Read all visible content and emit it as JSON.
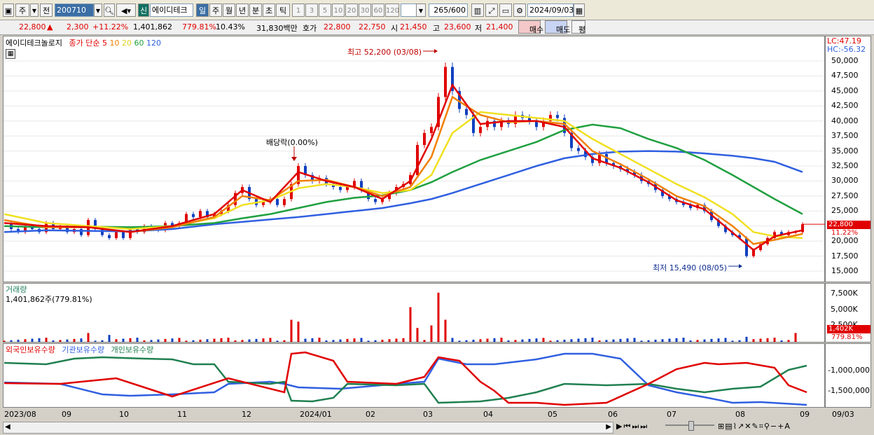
{
  "toolbar": {
    "period_label": "주",
    "prev_label": "전",
    "code_value": "200710",
    "new_badge": "신",
    "stock_name": "에이디테크",
    "periods": [
      "일",
      "주",
      "월",
      "년",
      "분",
      "초",
      "틱"
    ],
    "intervals": [
      "1",
      "3",
      "5",
      "10",
      "20",
      "30",
      "60",
      "120"
    ],
    "count_value": "265",
    "count_total": "/600",
    "date_value": "2024/09/03"
  },
  "quote": {
    "price": "22,800",
    "arrow": "▲",
    "change": "2,300",
    "change_pct": "+11.22%",
    "volume": "1,401,862",
    "volume_pct": "779.81%",
    "turnover": "10.43%",
    "amount": "31,830백만",
    "bid_label": "호가",
    "ask_price": "22,800",
    "bid_price": "22,750",
    "open_label": "시",
    "open": "21,450",
    "high_label": "고",
    "high": "23,600",
    "low_label": "저",
    "low": "21,400",
    "buy_button": "매수",
    "sell_button": "매도",
    "eval_button": "평"
  },
  "price_panel": {
    "name": "에이디테크놀로지",
    "ma_label": "종가 단순",
    "ma_periods": [
      "5",
      "10",
      "20",
      "60",
      "120"
    ],
    "ma_colors": [
      "#e00000",
      "#f08000",
      "#f0e020",
      "#20a040",
      "#3060e0"
    ],
    "lc": "LC:47.19",
    "hc": "HC:-56.32",
    "max_annotation": "최고 52,200 (03/08)",
    "min_annotation": "최저 15,490 (08/05)",
    "dividend_annotation": "배당락(0.00%)",
    "y_ticks": [
      "50,000",
      "47,500",
      "45,000",
      "42,500",
      "40,000",
      "37,500",
      "35,000",
      "32,500",
      "30,000",
      "27,500",
      "25,000",
      "22,500",
      "20,000",
      "17,500",
      "15,000"
    ],
    "current_tag": "22,800",
    "current_pct_tag": "11.22%"
  },
  "volume_panel": {
    "title": "거래량",
    "value": "1,401,862주(779.81%)",
    "y_ticks": [
      "7,500K",
      "5,000K",
      "2,500K"
    ],
    "current_tag": "1,402K",
    "current_pct_tag": "779.81%"
  },
  "holdings_panel": {
    "series": [
      "외국인보유수량",
      "기관보유수량",
      "개인보유수량"
    ],
    "colors": [
      "#e00000",
      "#3060e0",
      "#208050"
    ],
    "y_ticks": [
      "-1,000,000",
      "-1,500,000"
    ]
  },
  "x_labels": [
    "2023/08",
    "09",
    "10",
    "11",
    "12",
    "2024/01",
    "02",
    "03",
    "04",
    "05",
    "06",
    "07",
    "08",
    "09",
    "09/03"
  ],
  "chart_data": {
    "type": "line",
    "y_range": [
      14000,
      52500
    ],
    "close_path": [
      [
        0,
        23000
      ],
      [
        10,
        22000
      ],
      [
        20,
        21500
      ],
      [
        30,
        22500
      ],
      [
        40,
        22000
      ],
      [
        50,
        21500
      ],
      [
        60,
        23000
      ],
      [
        70,
        22000
      ],
      [
        80,
        22500
      ],
      [
        90,
        21500
      ],
      [
        100,
        22000
      ],
      [
        110,
        21000
      ],
      [
        120,
        23500
      ],
      [
        130,
        22000
      ],
      [
        140,
        21000
      ],
      [
        150,
        20500
      ],
      [
        160,
        21500
      ],
      [
        170,
        20500
      ],
      [
        180,
        22000
      ],
      [
        190,
        21500
      ],
      [
        200,
        22500
      ],
      [
        210,
        22000
      ],
      [
        220,
        21800
      ],
      [
        230,
        23000
      ],
      [
        240,
        22500
      ],
      [
        250,
        23000
      ],
      [
        260,
        24500
      ],
      [
        270,
        24000
      ],
      [
        280,
        25000
      ],
      [
        290,
        24000
      ],
      [
        300,
        24500
      ],
      [
        310,
        25000
      ],
      [
        320,
        26000
      ],
      [
        330,
        28000
      ],
      [
        340,
        29000
      ],
      [
        350,
        27000
      ],
      [
        360,
        26000
      ],
      [
        370,
        26500
      ],
      [
        380,
        27000
      ],
      [
        390,
        26000
      ],
      [
        400,
        27000
      ],
      [
        410,
        29500
      ],
      [
        420,
        32500
      ],
      [
        430,
        31000
      ],
      [
        440,
        30000
      ],
      [
        450,
        30500
      ],
      [
        460,
        29500
      ],
      [
        470,
        29000
      ],
      [
        480,
        28500
      ],
      [
        490,
        29000
      ],
      [
        500,
        30000
      ],
      [
        510,
        28500
      ],
      [
        520,
        27000
      ],
      [
        530,
        26500
      ],
      [
        540,
        27000
      ],
      [
        550,
        28000
      ],
      [
        560,
        29000
      ],
      [
        570,
        29500
      ],
      [
        580,
        31000
      ],
      [
        590,
        36000
      ],
      [
        600,
        38000
      ],
      [
        610,
        39000
      ],
      [
        620,
        44000
      ],
      [
        630,
        49000
      ],
      [
        640,
        45000
      ],
      [
        650,
        42000
      ],
      [
        660,
        41000
      ],
      [
        670,
        38000
      ],
      [
        680,
        39000
      ],
      [
        690,
        40000
      ],
      [
        700,
        39000
      ],
      [
        710,
        40000
      ],
      [
        720,
        39500
      ],
      [
        730,
        41000
      ],
      [
        740,
        40500
      ],
      [
        750,
        40000
      ],
      [
        760,
        39000
      ],
      [
        770,
        40000
      ],
      [
        780,
        41000
      ],
      [
        790,
        40500
      ],
      [
        800,
        38000
      ],
      [
        810,
        35500
      ],
      [
        820,
        35000
      ],
      [
        830,
        34000
      ],
      [
        840,
        33000
      ],
      [
        850,
        34500
      ],
      [
        860,
        33000
      ],
      [
        870,
        32500
      ],
      [
        880,
        32000
      ],
      [
        890,
        31500
      ],
      [
        900,
        31000
      ],
      [
        910,
        30000
      ],
      [
        920,
        29500
      ],
      [
        930,
        28500
      ],
      [
        940,
        27500
      ],
      [
        950,
        27000
      ],
      [
        960,
        26500
      ],
      [
        970,
        26000
      ],
      [
        980,
        25500
      ],
      [
        990,
        26000
      ],
      [
        1000,
        25000
      ],
      [
        1010,
        23500
      ],
      [
        1020,
        22500
      ],
      [
        1030,
        21500
      ],
      [
        1040,
        21000
      ],
      [
        1050,
        20500
      ],
      [
        1060,
        17500
      ],
      [
        1070,
        18500
      ],
      [
        1080,
        19500
      ],
      [
        1090,
        20500
      ],
      [
        1100,
        21500
      ],
      [
        1110,
        21000
      ],
      [
        1120,
        21500
      ],
      [
        1130,
        21500
      ],
      [
        1140,
        22800
      ]
    ],
    "ma5": [
      [
        0,
        23000
      ],
      [
        60,
        22500
      ],
      [
        120,
        22300
      ],
      [
        180,
        21500
      ],
      [
        240,
        22500
      ],
      [
        300,
        24500
      ],
      [
        340,
        28500
      ],
      [
        380,
        26500
      ],
      [
        420,
        31500
      ],
      [
        460,
        30000
      ],
      [
        500,
        29000
      ],
      [
        540,
        27000
      ],
      [
        580,
        30000
      ],
      [
        610,
        37000
      ],
      [
        640,
        46000
      ],
      [
        680,
        39500
      ],
      [
        720,
        40000
      ],
      [
        760,
        40000
      ],
      [
        800,
        39000
      ],
      [
        840,
        33800
      ],
      [
        880,
        32200
      ],
      [
        920,
        29800
      ],
      [
        960,
        26800
      ],
      [
        1000,
        25300
      ],
      [
        1040,
        21400
      ],
      [
        1070,
        18500
      ],
      [
        1100,
        20800
      ],
      [
        1140,
        21800
      ]
    ],
    "ma10": [
      [
        0,
        23500
      ],
      [
        60,
        22300
      ],
      [
        120,
        22300
      ],
      [
        180,
        21500
      ],
      [
        240,
        22300
      ],
      [
        300,
        24000
      ],
      [
        340,
        27500
      ],
      [
        380,
        26800
      ],
      [
        420,
        30000
      ],
      [
        460,
        30200
      ],
      [
        500,
        29000
      ],
      [
        540,
        27500
      ],
      [
        580,
        29000
      ],
      [
        610,
        34000
      ],
      [
        640,
        44000
      ],
      [
        680,
        41000
      ],
      [
        720,
        39800
      ],
      [
        760,
        40000
      ],
      [
        800,
        39500
      ],
      [
        840,
        35000
      ],
      [
        880,
        32800
      ],
      [
        920,
        30300
      ],
      [
        960,
        27500
      ],
      [
        1000,
        25800
      ],
      [
        1040,
        22500
      ],
      [
        1070,
        19500
      ],
      [
        1100,
        20200
      ],
      [
        1140,
        21200
      ]
    ],
    "ma20": [
      [
        0,
        24500
      ],
      [
        60,
        23000
      ],
      [
        120,
        22500
      ],
      [
        180,
        22000
      ],
      [
        240,
        22500
      ],
      [
        300,
        23800
      ],
      [
        340,
        26000
      ],
      [
        380,
        26800
      ],
      [
        420,
        28800
      ],
      [
        460,
        29500
      ],
      [
        500,
        29000
      ],
      [
        540,
        28000
      ],
      [
        580,
        28500
      ],
      [
        610,
        31000
      ],
      [
        640,
        38000
      ],
      [
        680,
        41500
      ],
      [
        720,
        41000
      ],
      [
        760,
        40500
      ],
      [
        800,
        40000
      ],
      [
        840,
        37000
      ],
      [
        880,
        34500
      ],
      [
        920,
        32000
      ],
      [
        960,
        29500
      ],
      [
        1000,
        27300
      ],
      [
        1040,
        24500
      ],
      [
        1070,
        21500
      ],
      [
        1100,
        20800
      ],
      [
        1140,
        20500
      ]
    ],
    "ma60": [
      [
        0,
        22500
      ],
      [
        60,
        22300
      ],
      [
        120,
        22400
      ],
      [
        180,
        22300
      ],
      [
        240,
        22500
      ],
      [
        300,
        23000
      ],
      [
        340,
        23800
      ],
      [
        380,
        24500
      ],
      [
        420,
        25500
      ],
      [
        460,
        26500
      ],
      [
        500,
        27200
      ],
      [
        540,
        27600
      ],
      [
        580,
        28500
      ],
      [
        610,
        29800
      ],
      [
        640,
        31500
      ],
      [
        680,
        33500
      ],
      [
        720,
        35000
      ],
      [
        760,
        36500
      ],
      [
        800,
        38500
      ],
      [
        840,
        39400
      ],
      [
        880,
        38800
      ],
      [
        920,
        37000
      ],
      [
        960,
        35500
      ],
      [
        1000,
        33500
      ],
      [
        1040,
        31000
      ],
      [
        1070,
        29000
      ],
      [
        1100,
        27000
      ],
      [
        1140,
        24500
      ]
    ],
    "ma120": [
      [
        0,
        21500
      ],
      [
        60,
        21800
      ],
      [
        120,
        21700
      ],
      [
        180,
        21600
      ],
      [
        240,
        22000
      ],
      [
        300,
        22800
      ],
      [
        340,
        23200
      ],
      [
        380,
        23600
      ],
      [
        420,
        24000
      ],
      [
        460,
        24500
      ],
      [
        500,
        25000
      ],
      [
        540,
        25500
      ],
      [
        580,
        26300
      ],
      [
        610,
        27000
      ],
      [
        640,
        28000
      ],
      [
        680,
        29500
      ],
      [
        720,
        31000
      ],
      [
        760,
        32500
      ],
      [
        800,
        33800
      ],
      [
        840,
        34500
      ],
      [
        880,
        34900
      ],
      [
        920,
        35000
      ],
      [
        960,
        34900
      ],
      [
        1000,
        34600
      ],
      [
        1040,
        34200
      ],
      [
        1070,
        33800
      ],
      [
        1100,
        33200
      ],
      [
        1140,
        31500
      ]
    ]
  }
}
